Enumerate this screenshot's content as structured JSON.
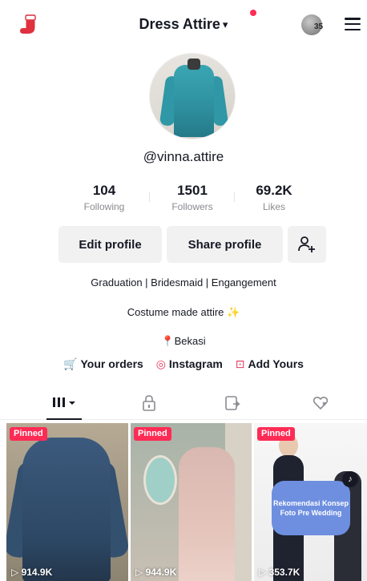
{
  "header": {
    "title": "Dress Attire",
    "notification_count": "35"
  },
  "profile": {
    "username": "@vinna.attire",
    "stats": [
      {
        "value": "104",
        "label": "Following"
      },
      {
        "value": "1501",
        "label": "Followers"
      },
      {
        "value": "69.2K",
        "label": "Likes"
      }
    ],
    "buttons": {
      "edit": "Edit profile",
      "share": "Share profile"
    },
    "bio_line1": "Graduation | Bridesmaid | Engangement",
    "bio_line2": "Costume made attire",
    "location": "Bekasi",
    "links": {
      "orders": "Your orders",
      "instagram": "Instagram",
      "add_yours": "Add Yours"
    }
  },
  "tabs": [
    "videos-grid-icon",
    "lock-icon",
    "repost-icon",
    "liked-icon"
  ],
  "videos": [
    {
      "badge": "Pinned",
      "views": "914.9K"
    },
    {
      "badge": "Pinned",
      "views": "944.9K"
    },
    {
      "badge": "Pinned",
      "views": "353.7K",
      "caption": "Rekomendasi Konsep Foto Pre Wedding"
    }
  ],
  "colors": {
    "accent": "#fe2c55",
    "callout": "#6e8fe0"
  }
}
